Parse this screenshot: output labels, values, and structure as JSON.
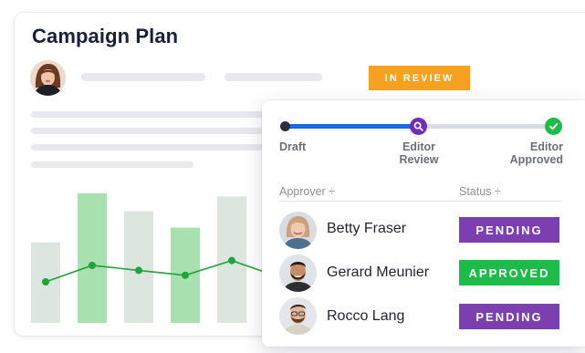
{
  "page": {
    "title": "Campaign Plan",
    "status_badge": "IN REVIEW"
  },
  "workflow": {
    "steps": [
      {
        "line1": "Draft",
        "line2": ""
      },
      {
        "line1": "Editor",
        "line2": "Review"
      },
      {
        "line1": "Editor",
        "line2": "Approved"
      }
    ],
    "current_step": 1
  },
  "table": {
    "headers": [
      "Approver ÷",
      "Status ÷"
    ],
    "rows": [
      {
        "name": "Betty Fraser",
        "status": "PENDING",
        "status_color": "#7b3fb0"
      },
      {
        "name": "Gerard Meunier",
        "status": "APPROVED",
        "status_color": "#1dbb49"
      },
      {
        "name": "Rocco Lang",
        "status": "PENDING",
        "status_color": "#7b3fb0"
      }
    ]
  },
  "colors": {
    "accent": "#1769e8",
    "review_badge": "#f6a11f",
    "bar": "#a9e0b0",
    "bar_faint": "#dde6de",
    "line": "#1fa33a"
  },
  "background_chart": {
    "type": "bar",
    "bar_values": [
      0.49,
      0.79,
      0.68,
      0.58,
      0.77
    ],
    "line_values": [
      0.25,
      0.35,
      0.32,
      0.29,
      0.38
    ]
  }
}
